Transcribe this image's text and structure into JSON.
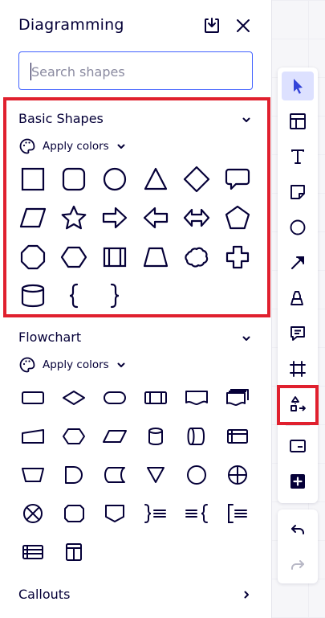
{
  "panel": {
    "title": "Diagramming",
    "import_icon": "import-icon",
    "close_icon": "close-icon"
  },
  "search": {
    "placeholder": "Search shapes",
    "value": ""
  },
  "sections": {
    "basic": {
      "title": "Basic Shapes",
      "apply_colors": "Apply colors",
      "expanded": true,
      "shapes": [
        "rectangle",
        "rounded-rectangle",
        "circle",
        "triangle",
        "rhombus",
        "speech-bubble",
        "parallelogram",
        "star",
        "arrow-right",
        "arrow-left",
        "arrow-both",
        "pentagon",
        "octagon",
        "hexagon",
        "predefined-process",
        "trapezoid",
        "cloud",
        "cross",
        "cylinder",
        "left-brace",
        "right-brace"
      ]
    },
    "flowchart": {
      "title": "Flowchart",
      "apply_colors": "Apply colors",
      "expanded": true,
      "shapes": [
        "process",
        "decision",
        "terminator",
        "predefined-process",
        "document",
        "multiple-documents",
        "manual-input",
        "preparation",
        "data",
        "database",
        "direct-access-storage",
        "internal-storage",
        "manual-operation",
        "delay",
        "stored-data",
        "merge",
        "connector",
        "or",
        "summing-junction",
        "off-page-connector",
        "off-page-reference",
        "annotation-right",
        "annotation-left",
        "annotation-bracket",
        "internal-storage-2",
        "vertical-container"
      ]
    },
    "callouts": {
      "title": "Callouts",
      "expanded": false
    }
  },
  "toolbar": {
    "tools": [
      "select",
      "templates",
      "text",
      "sticky-note",
      "shape",
      "connection-line",
      "pen",
      "comment",
      "frame",
      "diagramming",
      "card",
      "more-apps"
    ],
    "active": "select",
    "highlighted": "diagramming",
    "history": [
      "undo",
      "redo"
    ]
  },
  "colors": {
    "accent": "#4262ff",
    "ink": "#050038",
    "highlight": "#e0202e",
    "active_bg": "#dde1ff"
  }
}
